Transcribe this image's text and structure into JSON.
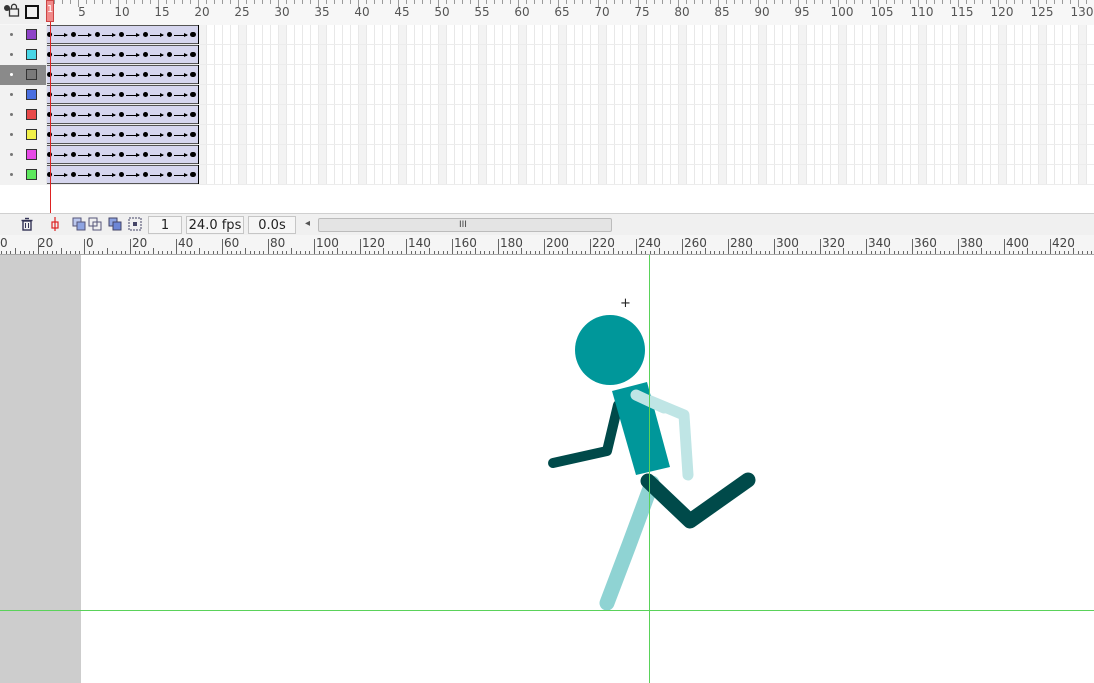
{
  "timeline": {
    "frame_ruler_labels": [
      "1",
      "5",
      "10",
      "15",
      "20",
      "25",
      "30",
      "35",
      "40",
      "45",
      "50",
      "55",
      "60",
      "65",
      "70",
      "75",
      "80",
      "85",
      "90",
      "95",
      "100",
      "105",
      "110",
      "115",
      "120",
      "125",
      "130"
    ],
    "current_frame_marker": "1",
    "layers": [
      {
        "color": "#8e44c8",
        "selected": false
      },
      {
        "color": "#49d6e6",
        "selected": false
      },
      {
        "color": "#7a7a7a",
        "selected": true
      },
      {
        "color": "#4a6fe0",
        "selected": false
      },
      {
        "color": "#e84a4a",
        "selected": false
      },
      {
        "color": "#f1f04a",
        "selected": false
      },
      {
        "color": "#e64ae6",
        "selected": false
      },
      {
        "color": "#5ee85e",
        "selected": false
      }
    ],
    "tween_span_frames": [
      1,
      19
    ]
  },
  "status_bar": {
    "current_frame": "1",
    "fps": "24.0 fps",
    "elapsed": "0.0s",
    "scroll_grip": "III",
    "scroll_left_arrow": "◂",
    "icons": [
      "trash-icon",
      "onion-skin-icon",
      "onion-outline-icon",
      "edit-multiple-frames-icon",
      "onion-marker-icon"
    ]
  },
  "stage_ruler": {
    "labels": [
      "0",
      "20",
      "0",
      "20",
      "40",
      "60",
      "80",
      "100",
      "120",
      "140",
      "160",
      "180",
      "200",
      "220",
      "240",
      "260",
      "280",
      "300",
      "320",
      "340",
      "360",
      "380",
      "400",
      "420"
    ]
  },
  "stage": {
    "background": "#ffffff",
    "pasteboard_color": "#cdcdcd",
    "guide_color": "#5ad25a",
    "figure": {
      "head_color": "#00979a",
      "torso_color": "#00979a",
      "near_limb_color": "#004a4a",
      "far_limb_color": "#8fd3d3"
    }
  }
}
